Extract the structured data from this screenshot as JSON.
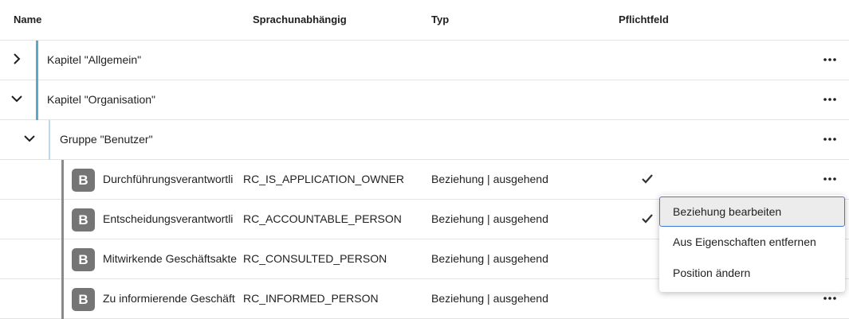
{
  "columns": {
    "name": "Name",
    "language_independent": "Sprachunabhängig",
    "type": "Typ",
    "required": "Pflichtfeld"
  },
  "colors": {
    "chapter_bar": "#5aa9c9",
    "group_bar": "#bcd9ea",
    "relation_bar": "#8a8a8a",
    "badge": "#757575",
    "focus_border": "#3d7bd9"
  },
  "chapters": [
    {
      "label": "Kapitel \"Allgemein\"",
      "expanded": false
    },
    {
      "label": "Kapitel \"Organisation\"",
      "expanded": true
    }
  ],
  "group": {
    "label": "Gruppe \"Benutzer\"",
    "expanded": true
  },
  "relations": [
    {
      "badge": "B",
      "name": "Durchführungsverantwortli",
      "key": "RC_IS_APPLICATION_OWNER",
      "type": "Beziehung | ausgehend",
      "required": true
    },
    {
      "badge": "B",
      "name": "Entscheidungsverantwortli",
      "key": "RC_ACCOUNTABLE_PERSON",
      "type": "Beziehung | ausgehend",
      "required": true
    },
    {
      "badge": "B",
      "name": "Mitwirkende Geschäftsakte",
      "key": "RC_CONSULTED_PERSON",
      "type": "Beziehung | ausgehend",
      "required": false
    },
    {
      "badge": "B",
      "name": "Zu informierende Geschäft",
      "key": "RC_INFORMED_PERSON",
      "type": "Beziehung | ausgehend",
      "required": false
    }
  ],
  "context_menu": {
    "items": [
      "Beziehung bearbeiten",
      "Aus Eigenschaften entfernen",
      "Position ändern"
    ],
    "active_index": 0
  }
}
